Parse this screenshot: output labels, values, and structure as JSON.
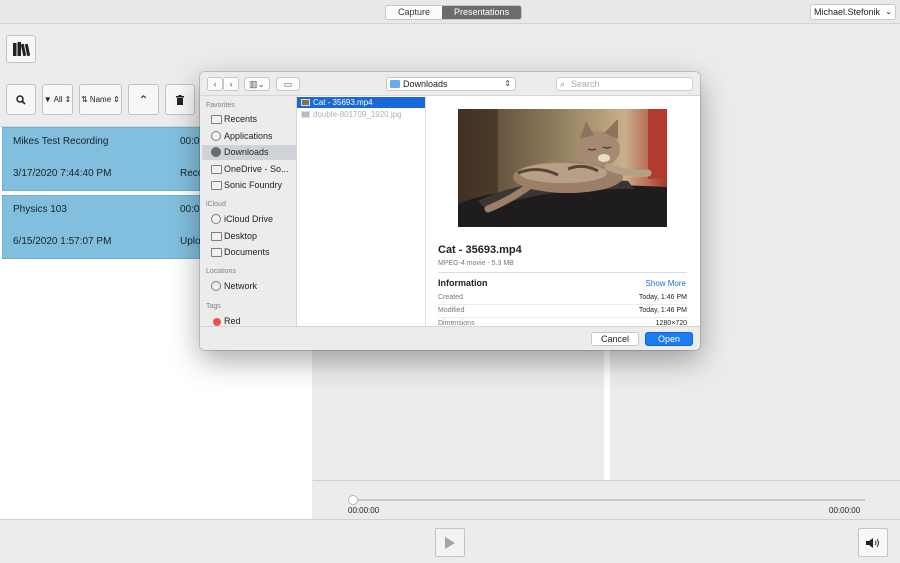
{
  "header": {
    "tabs": [
      {
        "label": "Capture",
        "active": false
      },
      {
        "label": "Presentations",
        "active": true
      }
    ],
    "user": "Michael.Stefonik"
  },
  "toolbar": {
    "filter_label": "All",
    "sort_label": "Name"
  },
  "recordings": [
    {
      "title": "Mikes Test Recording",
      "duration": "00:0",
      "date": "3/17/2020 7:44:40 PM",
      "status": "Reco"
    },
    {
      "title": "Physics 103",
      "duration": "00:0",
      "date": "6/15/2020 1:57:07 PM",
      "status": "Uplo"
    }
  ],
  "player": {
    "current_time": "00:00:00",
    "total_time": "00:00:00",
    "progress": 0
  },
  "dialog": {
    "location": "Downloads",
    "search_placeholder": "Search",
    "sidebar": {
      "favorites_title": "Favorites",
      "favorites": [
        "Recents",
        "Applications",
        "Downloads",
        "OneDrive - So...",
        "Sonic Foundry"
      ],
      "selected": "Downloads",
      "icloud_title": "iCloud",
      "icloud": [
        "iCloud Drive",
        "Desktop",
        "Documents"
      ],
      "locations_title": "Locations",
      "locations": [
        "Network"
      ],
      "tags_title": "Tags",
      "tags": [
        "Red"
      ]
    },
    "files": [
      {
        "name": "Cat - 35693.mp4",
        "selected": true
      },
      {
        "name": "double-801709_1920.jpg",
        "selected": false
      }
    ],
    "preview": {
      "name": "Cat - 35693.mp4",
      "kind_size": "MPEG-4 movie - 5.3 MB",
      "info_title": "Information",
      "show_more": "Show More",
      "rows": [
        {
          "label": "Created",
          "value": "Today, 1:46 PM"
        },
        {
          "label": "Modified",
          "value": "Today, 1:46 PM"
        },
        {
          "label": "Dimensions",
          "value": "1280×720"
        }
      ]
    },
    "buttons": {
      "cancel": "Cancel",
      "open": "Open"
    }
  },
  "colors": {
    "accent": "#1c7bf0",
    "selection": "#82bfde",
    "tag_red": "#ec5148"
  }
}
